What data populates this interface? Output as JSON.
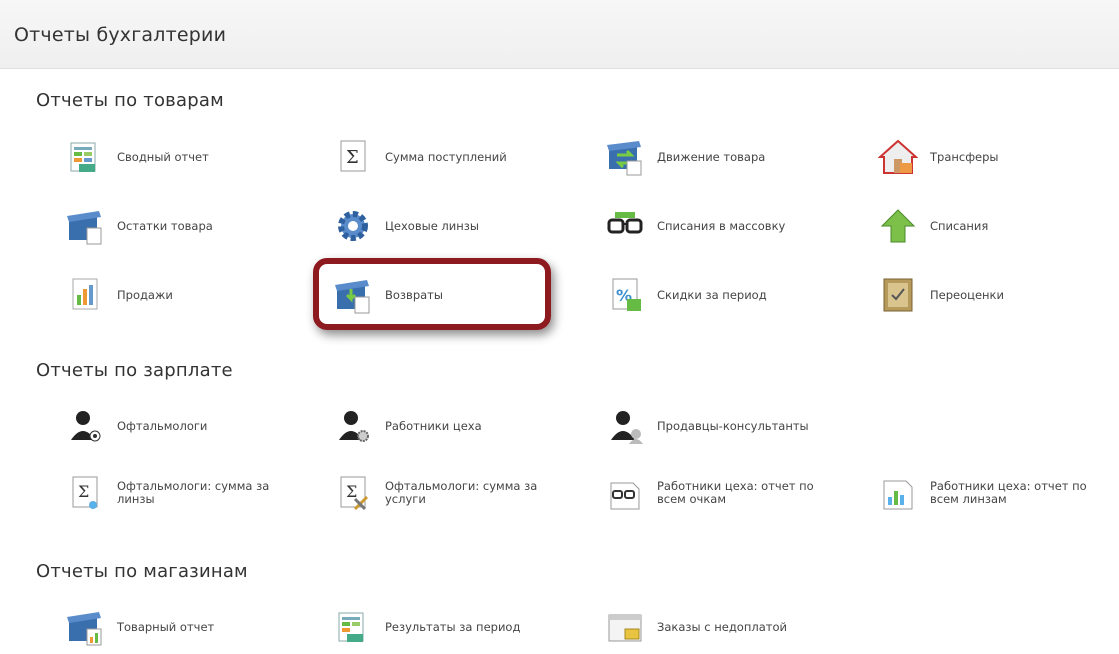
{
  "header": {
    "title": "Отчеты бухгалтерии"
  },
  "sections": [
    {
      "title": "Отчеты по товарам",
      "items": [
        {
          "label": "Сводный отчет",
          "icon": "spreadsheet-icon"
        },
        {
          "label": "Сумма поступлений",
          "icon": "sigma-document-icon"
        },
        {
          "label": "Движение товара",
          "icon": "box-arrows-icon"
        },
        {
          "label": "Трансферы",
          "icon": "house-icon"
        },
        {
          "label": "Остатки товара",
          "icon": "box-document-icon"
        },
        {
          "label": "Цеховые линзы",
          "icon": "gear-icon"
        },
        {
          "label": "Списания в массовку",
          "icon": "glasses-icon"
        },
        {
          "label": "Списания",
          "icon": "green-arrow-up-icon"
        },
        {
          "label": "Продажи",
          "icon": "bar-chart-icon"
        },
        {
          "label": "Возвраты",
          "icon": "box-return-icon"
        },
        {
          "label": "Скидки за период",
          "icon": "percent-document-icon"
        },
        {
          "label": "Переоценки",
          "icon": "notebook-icon"
        }
      ]
    },
    {
      "title": "Отчеты по зарплате",
      "items": [
        {
          "label": "Офтальмологи",
          "icon": "person-eye-icon"
        },
        {
          "label": "Работники цеха",
          "icon": "person-gear-icon"
        },
        {
          "label": "Продавцы-консультанты",
          "icon": "person-group-icon"
        },
        {
          "label": "Офтальмологи: сумма за\nлинзы",
          "icon": "sigma-lens-icon"
        },
        {
          "label": "Офтальмологи: сумма за\nуслуги",
          "icon": "sigma-tools-icon"
        },
        {
          "label": "Работники цеха: отчет по\nвсем очкам",
          "icon": "glasses-document-icon"
        },
        {
          "label": "Работники цеха: отчет по\nвсем линзам",
          "icon": "lens-chart-icon"
        }
      ]
    },
    {
      "title": "Отчеты по магазинам",
      "items": [
        {
          "label": "Товарный отчет",
          "icon": "box-chart-icon"
        },
        {
          "label": "Результаты за период",
          "icon": "spreadsheet-chart-icon"
        },
        {
          "label": "Заказы с недоплатой",
          "icon": "window-money-icon"
        }
      ]
    }
  ],
  "colors": {
    "highlight_border": "#8c1a1f",
    "header_bg": "#f3f3f3"
  }
}
